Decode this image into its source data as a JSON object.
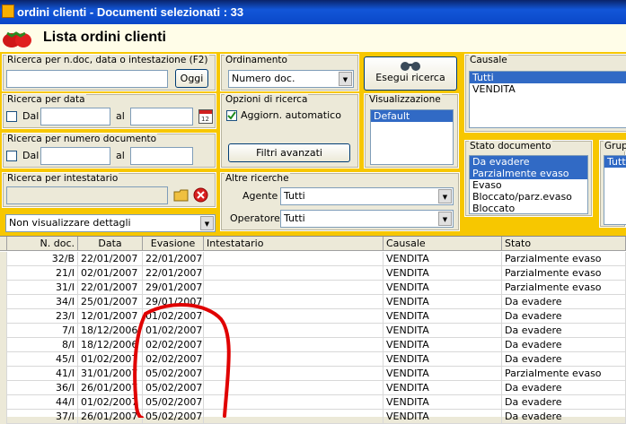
{
  "window": {
    "title": "ordini clienti - Documenti selezionati : 33"
  },
  "header": {
    "title": "Lista ordini clienti"
  },
  "search_main": {
    "legend": "Ricerca per n.doc, data o intestazione (F2)",
    "value": "",
    "button": "Oggi"
  },
  "search_date": {
    "legend": "Ricerca per data",
    "from_label": "Dal",
    "to_label": "al",
    "from_value": "",
    "to_value": ""
  },
  "search_number": {
    "legend": "Ricerca per numero documento",
    "from_label": "Dal",
    "to_label": "al",
    "from_value": "",
    "to_value": ""
  },
  "search_holder": {
    "legend": "Ricerca per intestatario",
    "value": ""
  },
  "details": {
    "selected": "Non visualizzare dettagli"
  },
  "ordering": {
    "legend": "Ordinamento",
    "selected": "Numero doc."
  },
  "options": {
    "legend": "Opzioni di ricerca",
    "auto_update_label": "Aggiorn. automatico",
    "auto_update_checked": true,
    "advanced_button": "Filtri avanzati"
  },
  "run_search": {
    "label": "Esegui ricerca"
  },
  "views": {
    "legend": "Visualizzazione",
    "items": [
      "Default"
    ],
    "selected": "Default"
  },
  "other": {
    "legend": "Altre ricerche",
    "agent_label": "Agente :",
    "agent_value": "Tutti",
    "operator_label": "Operatore :",
    "operator_value": "Tutti"
  },
  "causale": {
    "legend": "Causale",
    "items": [
      "Tutti",
      "VENDITA"
    ],
    "selected": [
      "Tutti"
    ]
  },
  "stato": {
    "legend": "Stato documento",
    "items": [
      "Da evadere",
      "Parzialmente evaso",
      "Evaso",
      "Bloccato/parz.evaso",
      "Bloccato"
    ],
    "selected": [
      "Da evadere",
      "Parzialmente evaso"
    ]
  },
  "group": {
    "legend": "Grup",
    "items": [
      "Tutti"
    ],
    "selected": [
      "Tutti"
    ]
  },
  "table": {
    "columns": [
      "N. doc.",
      "Data",
      "Evasione",
      "Intestatario",
      "Causale",
      "Stato"
    ],
    "rows": [
      [
        "32/B",
        "22/01/2007",
        "22/01/2007",
        "",
        "VENDITA",
        "Parzialmente evaso"
      ],
      [
        "21/I",
        "02/01/2007",
        "22/01/2007",
        "",
        "VENDITA",
        "Parzialmente evaso"
      ],
      [
        "31/I",
        "22/01/2007",
        "29/01/2007",
        "",
        "VENDITA",
        "Parzialmente evaso"
      ],
      [
        "34/I",
        "25/01/2007",
        "29/01/2007",
        "",
        "VENDITA",
        "Da evadere"
      ],
      [
        "23/I",
        "12/01/2007",
        "01/02/2007",
        "",
        "VENDITA",
        "Da evadere"
      ],
      [
        "7/I",
        "18/12/2006",
        "01/02/2007",
        "",
        "VENDITA",
        "Da evadere"
      ],
      [
        "8/I",
        "18/12/2006",
        "02/02/2007",
        "",
        "VENDITA",
        "Da evadere"
      ],
      [
        "45/I",
        "01/02/2007",
        "02/02/2007",
        "",
        "VENDITA",
        "Da evadere"
      ],
      [
        "41/I",
        "31/01/2007",
        "05/02/2007",
        "",
        "VENDITA",
        "Parzialmente evaso"
      ],
      [
        "36/I",
        "26/01/2007",
        "05/02/2007",
        "",
        "VENDITA",
        "Da evadere"
      ],
      [
        "44/I",
        "01/02/2007",
        "05/02/2007",
        "",
        "VENDITA",
        "Da evadere"
      ],
      [
        "37/I",
        "26/01/2007",
        "05/02/2007",
        "",
        "VENDITA",
        "Da evadere"
      ]
    ]
  },
  "colors": {
    "title_bar": "#0a47c8",
    "accent_band": "#f7c700",
    "selection": "#316ac5",
    "scribble": "#e00000"
  },
  "icons": {
    "app": "strawberry-icon",
    "binoculars": "binoculars-icon",
    "calendar": "calendar-icon",
    "folder": "folder-icon",
    "clear": "clear-icon"
  }
}
